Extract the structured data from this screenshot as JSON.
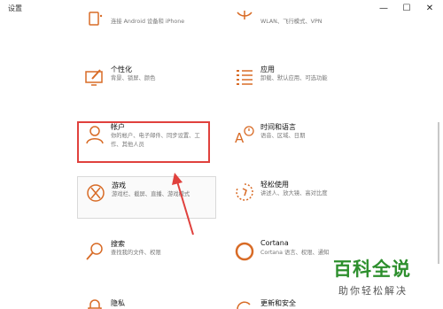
{
  "window": {
    "title": "设置",
    "minimize_glyph": "—",
    "maximize_glyph": "☐",
    "close_glyph": "✕"
  },
  "tiles": {
    "phone": {
      "subtitle": "连接 Android 设备和 iPhone"
    },
    "network": {
      "subtitle": "WLAN、飞行模式、VPN"
    },
    "personalization": {
      "title": "个性化",
      "subtitle": "背景、锁屏、颜色"
    },
    "apps": {
      "title": "应用",
      "subtitle": "卸载、默认应用、可选功能"
    },
    "accounts": {
      "title": "帐户",
      "subtitle": "你的帐户、电子邮件、同步设置、工作、其他人员"
    },
    "time_language": {
      "title": "时间和语言",
      "subtitle": "语音、区域、日期"
    },
    "gaming": {
      "title": "游戏",
      "subtitle": "游戏栏、截屏、直播、游戏模式"
    },
    "ease_of_access": {
      "title": "轻松使用",
      "subtitle": "讲述人、放大镜、高对比度"
    },
    "search": {
      "title": "搜索",
      "subtitle": "查找我的文件、权限"
    },
    "cortana": {
      "title": "Cortana",
      "subtitle": "Cortana 语言、权限、通知"
    },
    "privacy": {
      "title": "隐私"
    },
    "update_security": {
      "title": "更新和安全"
    }
  },
  "watermark": {
    "brand": "百科全说",
    "slogan": "助你轻松解决"
  },
  "colors": {
    "accent": "#d86b26",
    "highlight_box": "#e0413d",
    "watermark": "#2d8f2d"
  }
}
